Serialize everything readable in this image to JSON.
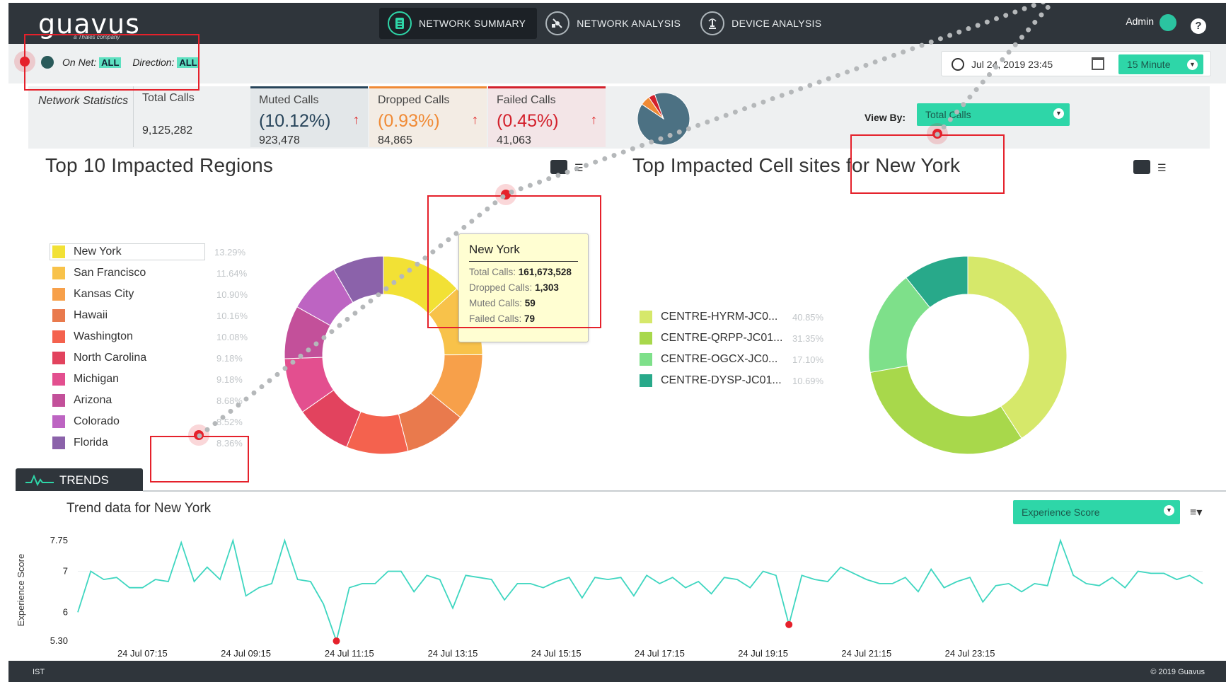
{
  "brand": {
    "name": "guavus",
    "tagline": "a Thales company"
  },
  "nav": {
    "tabs": [
      {
        "label": "NETWORK SUMMARY",
        "icon": "document-icon",
        "active": true
      },
      {
        "label": "NETWORK ANALYSIS",
        "icon": "satellite-icon",
        "active": false
      },
      {
        "label": "DEVICE ANALYSIS",
        "icon": "tower-icon",
        "active": false
      }
    ],
    "user": "Admin",
    "help": "?"
  },
  "filters": {
    "on_net_label": "On Net:",
    "on_net_value": "ALL",
    "direction_label": "Direction:",
    "direction_value": "ALL"
  },
  "timebar": {
    "datetime": "Jul 24, 2019 23:45",
    "interval": "15 Minute"
  },
  "stats": {
    "label": "Network Statistics",
    "total": {
      "title": "Total Calls",
      "value": "9,125,282"
    },
    "muted": {
      "title": "Muted Calls",
      "pct": "(10.12%)",
      "value": "923,478",
      "color": "#27445a"
    },
    "dropped": {
      "title": "Dropped Calls",
      "pct": "(0.93%)",
      "value": "84,865",
      "color": "#f08a35"
    },
    "failed": {
      "title": "Failed Calls",
      "pct": "(0.45%)",
      "value": "41,063",
      "color": "#d3212c"
    },
    "view_by_label": "View By:",
    "view_by_value": "Total Calls"
  },
  "regions": {
    "title": "Top 10 Impacted Regions",
    "items": [
      {
        "name": "New York",
        "pct": "13.29%",
        "color": "#f2e135"
      },
      {
        "name": "San Francisco",
        "pct": "11.64%",
        "color": "#f8c24a"
      },
      {
        "name": "Kansas City",
        "pct": "10.90%",
        "color": "#f7a04a"
      },
      {
        "name": "Hawaii",
        "pct": "10.16%",
        "color": "#e97a4d"
      },
      {
        "name": "Washington",
        "pct": "10.08%",
        "color": "#f4624e"
      },
      {
        "name": "North Carolina",
        "pct": "9.18%",
        "color": "#e2435e"
      },
      {
        "name": "Michigan",
        "pct": "9.18%",
        "color": "#e34f8f"
      },
      {
        "name": "Arizona",
        "pct": "8.68%",
        "color": "#c3509a"
      },
      {
        "name": "Colorado",
        "pct": "8.52%",
        "color": "#bd64c2"
      },
      {
        "name": "Florida",
        "pct": "8.36%",
        "color": "#8b62aa"
      }
    ],
    "tooltip": {
      "title": "New York",
      "total_label": "Total Calls:",
      "total_value": "161,673,528",
      "dropped_label": "Dropped Calls:",
      "dropped_value": "1,303",
      "muted_label": "Muted Calls:",
      "muted_value": "59",
      "failed_label": "Failed Calls:",
      "failed_value": "79"
    }
  },
  "cells": {
    "title": "Top Impacted Cell sites for New York",
    "items": [
      {
        "name": "CENTRE-HYRM-JC0...",
        "pct": "40.85%",
        "color": "#d6e86a"
      },
      {
        "name": "CENTRE-QRPP-JC01...",
        "pct": "31.35%",
        "color": "#a8d84b"
      },
      {
        "name": "CENTRE-OGCX-JC0...",
        "pct": "17.10%",
        "color": "#7ee08a"
      },
      {
        "name": "CENTRE-DYSP-JC01...",
        "pct": "10.69%",
        "color": "#28a98a"
      }
    ]
  },
  "status_pie": {
    "slices": [
      0.9,
      0.06,
      0.04
    ],
    "colors": [
      "#4c7183",
      "#f08a35",
      "#d3212c"
    ]
  },
  "trends": {
    "tab_label": "TRENDS",
    "title": "Trend data for New York",
    "metric": "Experience Score",
    "menu": "≡▾"
  },
  "chart_data": {
    "type": "line",
    "ylabel": "Experience Score",
    "yticks": [
      "7.75",
      "7",
      "6",
      "5.30"
    ],
    "ylim": [
      5.3,
      7.75
    ],
    "xticks": [
      "24 Jul 07:15",
      "24 Jul 09:15",
      "24 Jul 11:15",
      "24 Jul 13:15",
      "24 Jul 15:15",
      "24 Jul 17:15",
      "24 Jul 19:15",
      "24 Jul 21:15",
      "24 Jul 23:15"
    ],
    "start": "24 Jul 06:00",
    "interval_minutes": 15,
    "color": "#3ed6c0",
    "series": [
      {
        "values": [
          6.0,
          7.0,
          6.8,
          6.85,
          6.6,
          6.6,
          6.8,
          6.75,
          7.7,
          6.75,
          7.1,
          6.8,
          7.75,
          6.4,
          6.6,
          6.7,
          7.75,
          6.8,
          6.75,
          6.2,
          5.3,
          6.6,
          6.7,
          6.7,
          7.0,
          7.0,
          6.5,
          6.9,
          6.8,
          6.1,
          6.9,
          6.85,
          6.8,
          6.3,
          6.7,
          6.7,
          6.6,
          6.75,
          6.85,
          6.35,
          6.85,
          6.8,
          6.85,
          6.4,
          6.9,
          6.7,
          6.85,
          6.6,
          6.75,
          6.45,
          6.85,
          6.8,
          6.6,
          7.0,
          6.9,
          5.7,
          6.9,
          6.8,
          6.75,
          7.1,
          6.95,
          6.8,
          6.7,
          6.7,
          6.85,
          6.5,
          7.05,
          6.6,
          6.75,
          6.85,
          6.25,
          6.65,
          6.7,
          6.5,
          6.7,
          6.65,
          7.75,
          6.9,
          6.7,
          6.65,
          6.85,
          6.6,
          7.0,
          6.95,
          6.95,
          6.8,
          6.9,
          6.7
        ]
      }
    ],
    "highlighted_points": [
      20,
      55
    ]
  }
}
